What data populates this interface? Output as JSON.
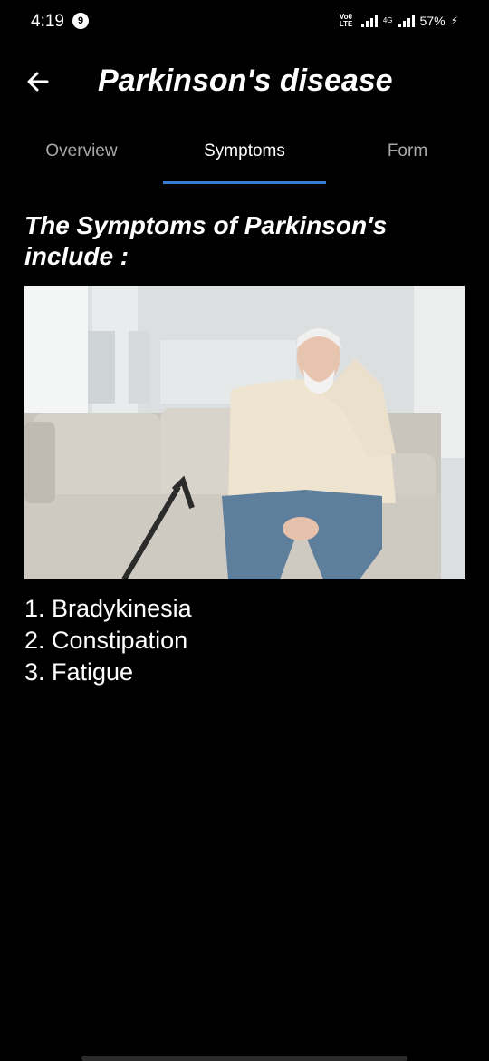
{
  "status_bar": {
    "time": "4:19",
    "notification_count": "9",
    "volte": "Vo0\nLTE",
    "network": "4G",
    "battery": "57%"
  },
  "header": {
    "title": "Parkinson's disease",
    "back_icon": "arrow-left-icon"
  },
  "tabs": [
    {
      "label": "Overview",
      "active": false
    },
    {
      "label": "Symptoms",
      "active": true
    },
    {
      "label": "Form",
      "active": false
    }
  ],
  "content": {
    "heading": "The Symptoms of Parkinson's include :",
    "symptoms": [
      "1. Bradykinesia",
      "2. Constipation",
      "3. Fatigue"
    ]
  },
  "colors": {
    "background": "#000000",
    "accent": "#3a7bd5",
    "inactive_tab": "#a9a9a9"
  }
}
